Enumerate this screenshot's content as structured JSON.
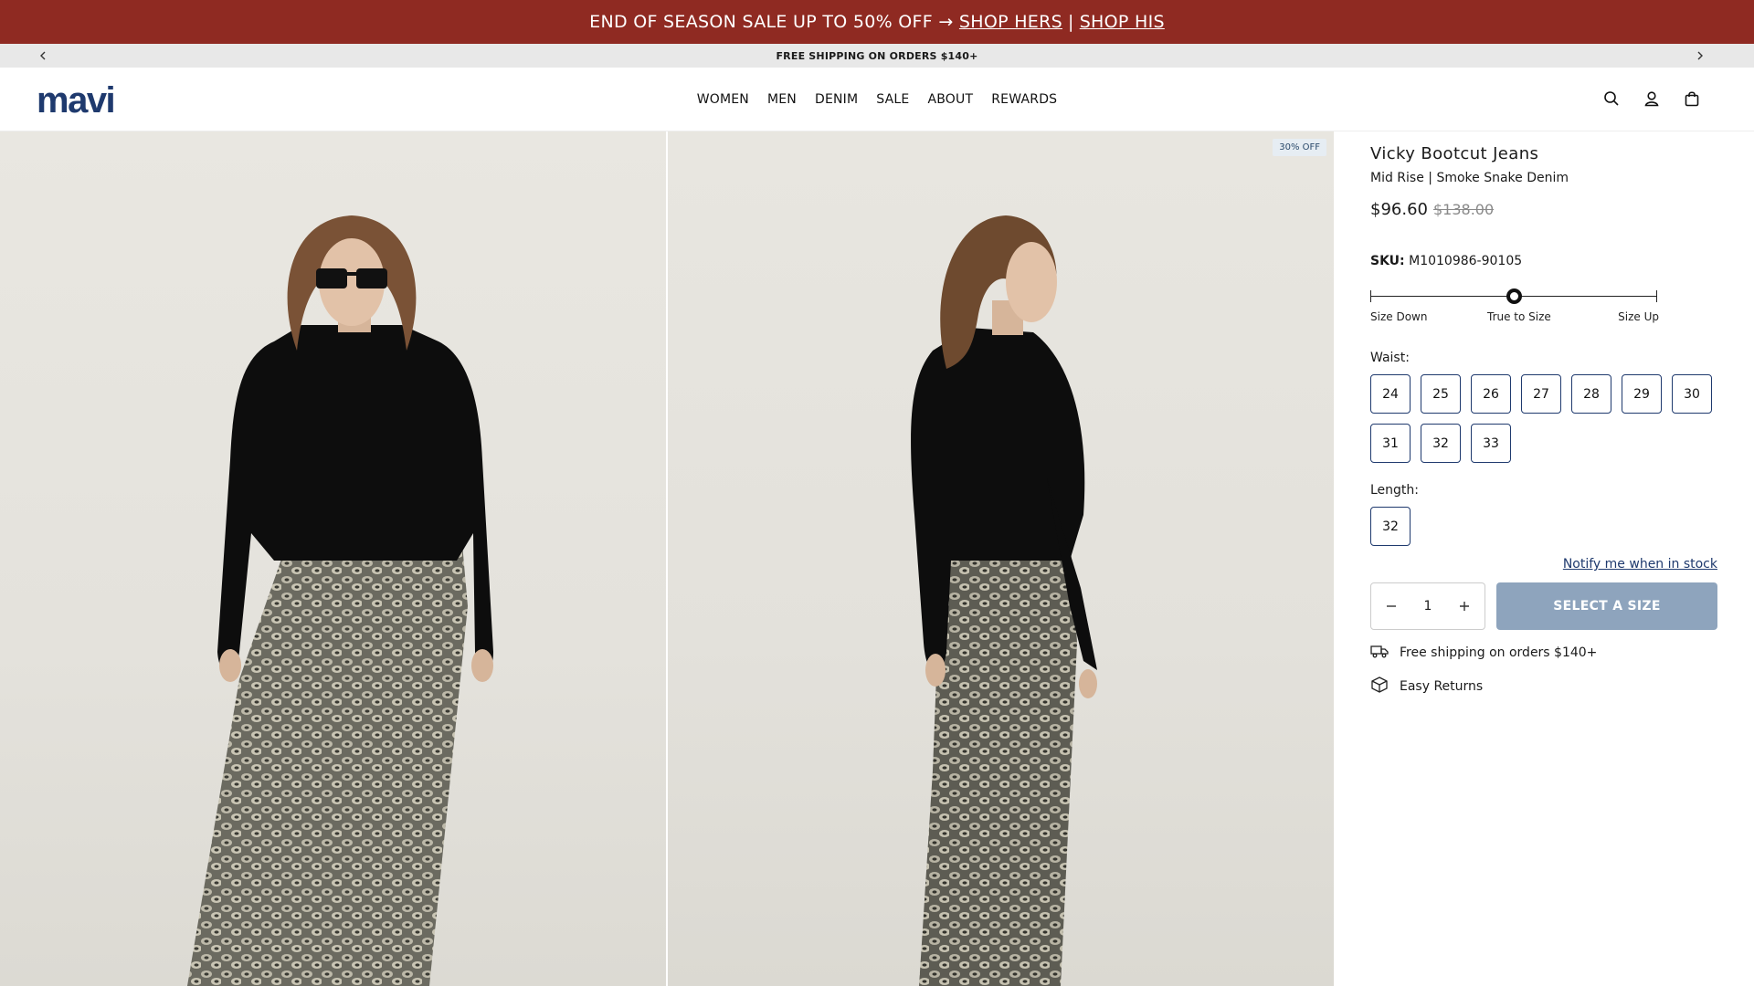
{
  "promo": {
    "text": "END OF SEASON SALE UP TO 50% OFF →",
    "link_hers": "SHOP HERS",
    "separator": "|",
    "link_his": "SHOP HIS"
  },
  "ticker": {
    "text": "FREE SHIPPING ON ORDERS $140+",
    "prev_icon": "chevron-left-icon",
    "next_icon": "chevron-right-icon"
  },
  "header": {
    "logo": "mavi",
    "nav": [
      "WOMEN",
      "MEN",
      "DENIM",
      "SALE",
      "ABOUT",
      "REWARDS"
    ],
    "icons": [
      "search-icon",
      "account-icon",
      "bag-icon"
    ]
  },
  "gallery": {
    "badge": "30% OFF"
  },
  "product": {
    "title": "Vicky Bootcut Jeans",
    "subtitle": "Mid Rise | Smoke Snake Denim",
    "price": "$96.60",
    "compare_price": "$138.00",
    "sku_label": "SKU:",
    "sku_value": "M1010986-90105",
    "fit": {
      "labels": [
        "Size Down",
        "True to Size",
        "Size Up"
      ],
      "position": 0.5
    },
    "waist_label": "Waist:",
    "waist_sizes": [
      "24",
      "25",
      "26",
      "27",
      "28",
      "29",
      "30",
      "31",
      "32",
      "33"
    ],
    "length_label": "Length:",
    "length_sizes": [
      "32"
    ],
    "notify": "Notify me when in stock",
    "quantity": "1",
    "select_button": "SELECT A SIZE",
    "perks": [
      {
        "icon": "truck-icon",
        "text": "Free shipping on orders $140+"
      },
      {
        "icon": "box-icon",
        "text": "Easy Returns"
      }
    ]
  }
}
